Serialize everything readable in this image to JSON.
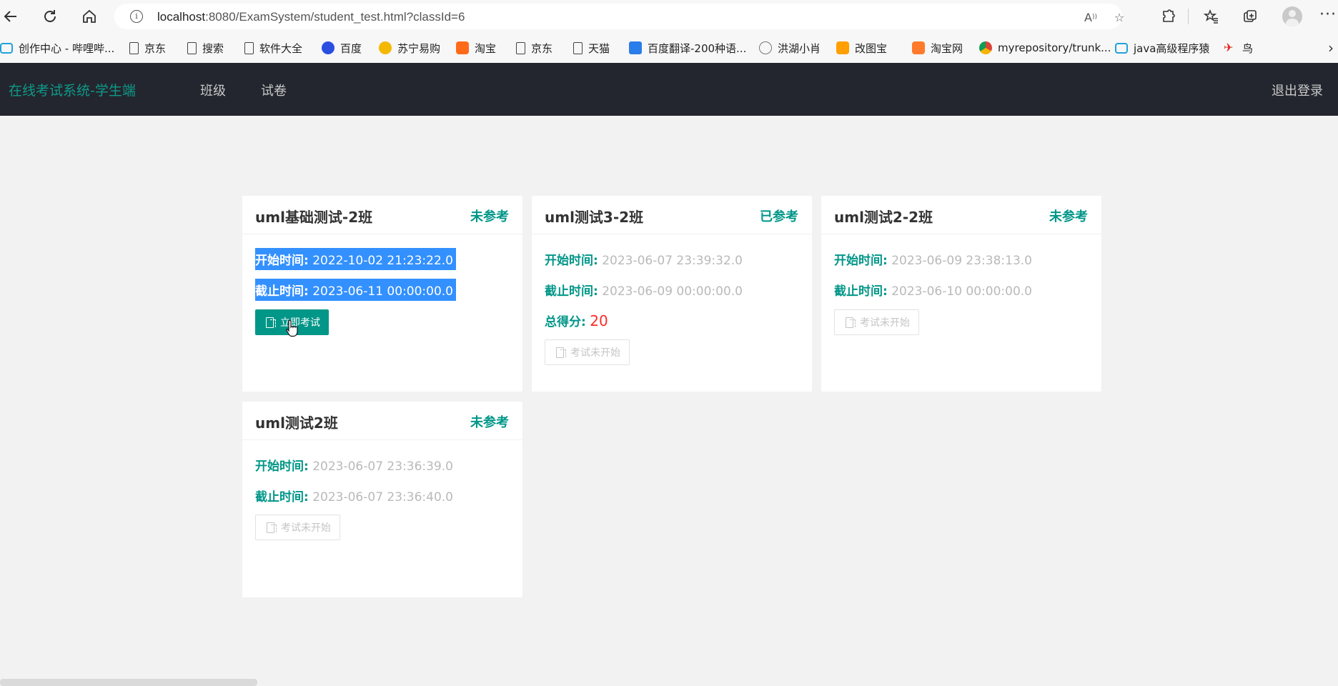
{
  "browser": {
    "url_host": "localhost",
    "url_rest": ":8080/ExamSystem/student_test.html?classId=6",
    "read_aloud_icon": "read-aloud-icon",
    "bookmarks": [
      {
        "label": "创作中心 - 哔哩哔...",
        "icon": "bilibili-icon"
      },
      {
        "label": "京东",
        "icon": "file-icon"
      },
      {
        "label": "搜索",
        "icon": "file-icon"
      },
      {
        "label": "软件大全",
        "icon": "file-icon"
      },
      {
        "label": "百度",
        "icon": "baidu-icon"
      },
      {
        "label": "苏宁易购",
        "icon": "suning-icon"
      },
      {
        "label": "淘宝",
        "icon": "taobao-icon"
      },
      {
        "label": "京东",
        "icon": "file-icon"
      },
      {
        "label": "天猫",
        "icon": "file-icon"
      },
      {
        "label": "百度翻译-200种语...",
        "icon": "baidu-translate-icon"
      },
      {
        "label": "洪湖小肖",
        "icon": "bird-icon"
      },
      {
        "label": "改图宝",
        "icon": "gaitubao-icon"
      },
      {
        "label": "淘宝网",
        "icon": "taobao-icon"
      },
      {
        "label": "myrepository/trunk...",
        "icon": "chrome-icon"
      },
      {
        "label": "java高级程序猿",
        "icon": "bilibili-icon"
      },
      {
        "label": "鸟",
        "icon": "bird-red-icon"
      }
    ]
  },
  "app": {
    "brand": "在线考试系统-学生端",
    "nav": [
      "班级",
      "试卷"
    ],
    "logout": "退出登录",
    "accent": "#009688",
    "nav_bg": "#23262e"
  },
  "cards": [
    {
      "title": "uml基础测试-2班",
      "status": "未参考",
      "start_label": "开始时间:",
      "start": "2022-10-02 21:23:22.0",
      "end_label": "截止时间:",
      "end": "2023-06-11 00:00:00.0",
      "button": "立即考试",
      "button_state": "primary"
    },
    {
      "title": "uml测试3-2班",
      "status": "已参考",
      "start_label": "开始时间:",
      "start": "2023-06-07 23:39:32.0",
      "end_label": "截止时间:",
      "end": "2023-06-09 00:00:00.0",
      "score_label": "总得分:",
      "score": "20",
      "button": "考试未开始",
      "button_state": "disabled"
    },
    {
      "title": "uml测试2-2班",
      "status": "未参考",
      "start_label": "开始时间:",
      "start": "2023-06-09 23:38:13.0",
      "end_label": "截止时间:",
      "end": "2023-06-10 00:00:00.0",
      "button": "考试未开始",
      "button_state": "disabled"
    },
    {
      "title": "uml测试2班",
      "status": "未参考",
      "start_label": "开始时间:",
      "start": "2023-06-07 23:36:39.0",
      "end_label": "截止时间:",
      "end": "2023-06-07 23:36:40.0",
      "button": "考试未开始",
      "button_state": "disabled"
    }
  ]
}
